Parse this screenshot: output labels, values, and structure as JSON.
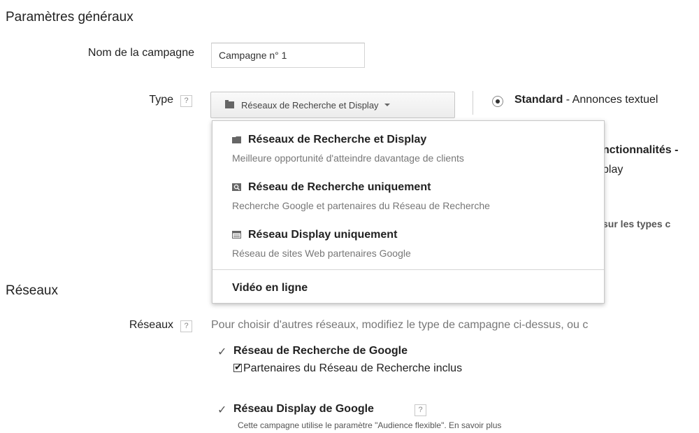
{
  "general": {
    "title": "Paramètres généraux",
    "name_label": "Nom de la campagne",
    "name_value": "Campagne n° 1",
    "type_label": "Type",
    "help_glyph": "?",
    "type_button_label": "Réseaux de Recherche et Display",
    "radio_label_bold": "Standard",
    "radio_label_rest": " - Annonces textuel",
    "behind_text_1": "nctionnalités -",
    "behind_text_2": "play",
    "behind_text_3": "sur les types c"
  },
  "dropdown": {
    "items": [
      {
        "title": "Réseaux de Recherche et Display",
        "desc": "Meilleure opportunité d'atteindre davantage de clients",
        "icon": "folder-icon"
      },
      {
        "title": "Réseau de Recherche uniquement",
        "desc": "Recherche Google et partenaires du Réseau de Recherche",
        "icon": "search-network-icon"
      },
      {
        "title": "Réseau Display uniquement",
        "desc": "Réseau de sites Web partenaires Google",
        "icon": "display-network-icon"
      }
    ],
    "video_label": "Vidéo en ligne"
  },
  "networks": {
    "title": "Réseaux",
    "label": "Réseaux",
    "intro": "Pour choisir d'autres réseaux, modifiez le type de campagne ci-dessus, ou c",
    "search_title": "Réseau de Recherche de Google",
    "search_partners": "Partenaires du Réseau de Recherche inclus",
    "display_title": "Réseau Display de Google",
    "display_note": "Cette campagne utilise le paramètre \"Audience flexible\". En savoir plus"
  },
  "icons": {
    "checkmark": "✓"
  },
  "colors": {
    "dropdown_border": "#c8c8c8",
    "muted_text": "#777777"
  }
}
